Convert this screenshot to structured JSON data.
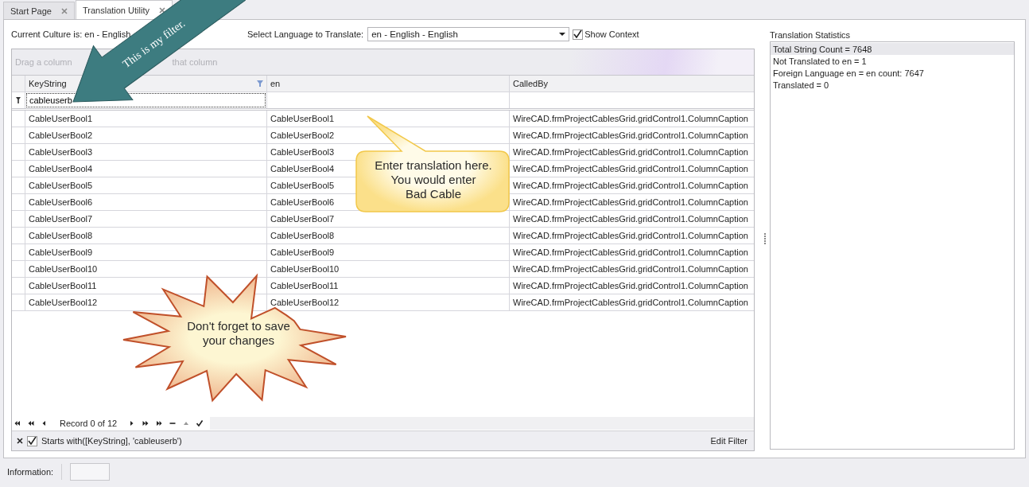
{
  "tabs": [
    {
      "label": "Start Page",
      "selected": false
    },
    {
      "label": "Translation Utility",
      "selected": true
    }
  ],
  "culture_label": "Current Culture is: en - English",
  "language_label": "Select Language to Translate:",
  "language_value": "en - English - English",
  "show_context": {
    "label": "Show Context",
    "checked": true
  },
  "grid": {
    "group_panel_hint": [
      "Drag a column",
      "that column"
    ],
    "columns": [
      {
        "label": "KeyString",
        "filtered": true
      },
      {
        "label": "en",
        "filtered": false
      },
      {
        "label": "CalledBy",
        "filtered": false
      }
    ],
    "filter_value": "cableuserb",
    "rows": [
      {
        "key": "CableUserBool1",
        "en": "CableUserBool1",
        "called_by": "WireCAD.frmProjectCablesGrid.gridControl1.ColumnCaption"
      },
      {
        "key": "CableUserBool2",
        "en": "CableUserBool2",
        "called_by": "WireCAD.frmProjectCablesGrid.gridControl1.ColumnCaption"
      },
      {
        "key": "CableUserBool3",
        "en": "CableUserBool3",
        "called_by": "WireCAD.frmProjectCablesGrid.gridControl1.ColumnCaption"
      },
      {
        "key": "CableUserBool4",
        "en": "CableUserBool4",
        "called_by": "WireCAD.frmProjectCablesGrid.gridControl1.ColumnCaption"
      },
      {
        "key": "CableUserBool5",
        "en": "CableUserBool5",
        "called_by": "WireCAD.frmProjectCablesGrid.gridControl1.ColumnCaption"
      },
      {
        "key": "CableUserBool6",
        "en": "CableUserBool6",
        "called_by": "WireCAD.frmProjectCablesGrid.gridControl1.ColumnCaption"
      },
      {
        "key": "CableUserBool7",
        "en": "CableUserBool7",
        "called_by": "WireCAD.frmProjectCablesGrid.gridControl1.ColumnCaption"
      },
      {
        "key": "CableUserBool8",
        "en": "CableUserBool8",
        "called_by": "WireCAD.frmProjectCablesGrid.gridControl1.ColumnCaption"
      },
      {
        "key": "CableUserBool9",
        "en": "CableUserBool9",
        "called_by": "WireCAD.frmProjectCablesGrid.gridControl1.ColumnCaption"
      },
      {
        "key": "CableUserBool10",
        "en": "CableUserBool10",
        "called_by": "WireCAD.frmProjectCablesGrid.gridControl1.ColumnCaption"
      },
      {
        "key": "CableUserBool11",
        "en": "CableUserBool11",
        "called_by": "WireCAD.frmProjectCablesGrid.gridControl1.ColumnCaption"
      },
      {
        "key": "CableUserBool12",
        "en": "CableUserBool12",
        "called_by": "WireCAD.frmProjectCablesGrid.gridControl1.ColumnCaption"
      }
    ],
    "navigator": {
      "record_text": "Record 0 of 12"
    },
    "filter_panel": {
      "expression": "Starts with([KeyString], 'cableuserb')",
      "enabled": true,
      "edit_label": "Edit Filter"
    }
  },
  "statistics": {
    "title": "Translation Statistics",
    "items": [
      {
        "text": "Total String Count = 7648",
        "selected": true
      },
      {
        "text": "Not Translated to en = 1",
        "selected": false
      },
      {
        "text": "Foreign Language en = en count: 7647",
        "selected": false
      },
      {
        "text": "Translated = 0",
        "selected": false
      }
    ]
  },
  "status_bar": {
    "label": "Information:"
  },
  "annotations": [
    {
      "kind": "arrow",
      "text": "This is my filter."
    },
    {
      "kind": "callout",
      "text": "Enter translation here.\nYou would enter\nBad Cable"
    },
    {
      "kind": "starburst",
      "text": "Don't forget to save\nyour changes"
    }
  ]
}
